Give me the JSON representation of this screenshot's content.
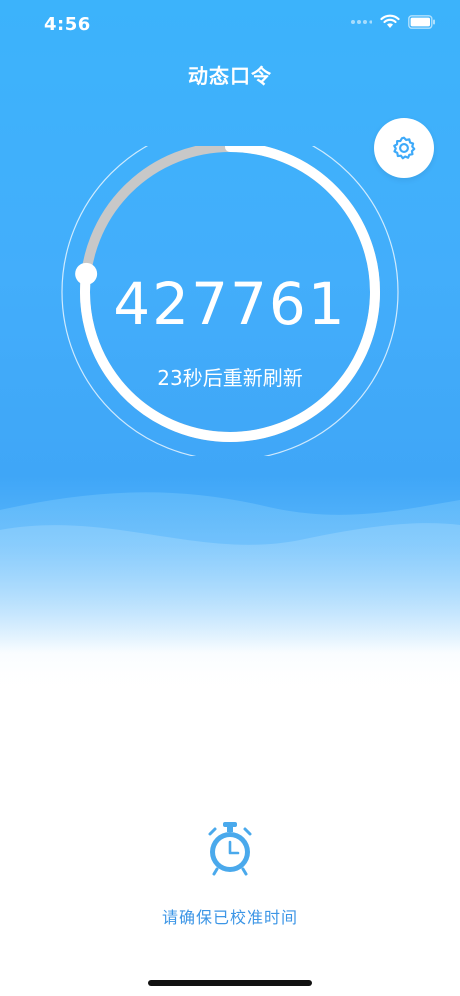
{
  "status_bar": {
    "time": "4:56",
    "icons": [
      "signal-dots-icon",
      "wifi-icon",
      "battery-icon"
    ]
  },
  "header": {
    "title": "动态口令",
    "settings_icon": "gear-icon"
  },
  "token": {
    "code": "427761",
    "countdown_text": "23秒后重新刷新",
    "remaining_fraction": 0.77
  },
  "footer": {
    "icon": "alarm-clock-icon",
    "hint": "请确保已校准时间"
  },
  "colors": {
    "primary": "#3faaf9",
    "ring_track": "#c8c8c8",
    "ring_progress": "#ffffff",
    "hint_text": "#3d96e6"
  }
}
